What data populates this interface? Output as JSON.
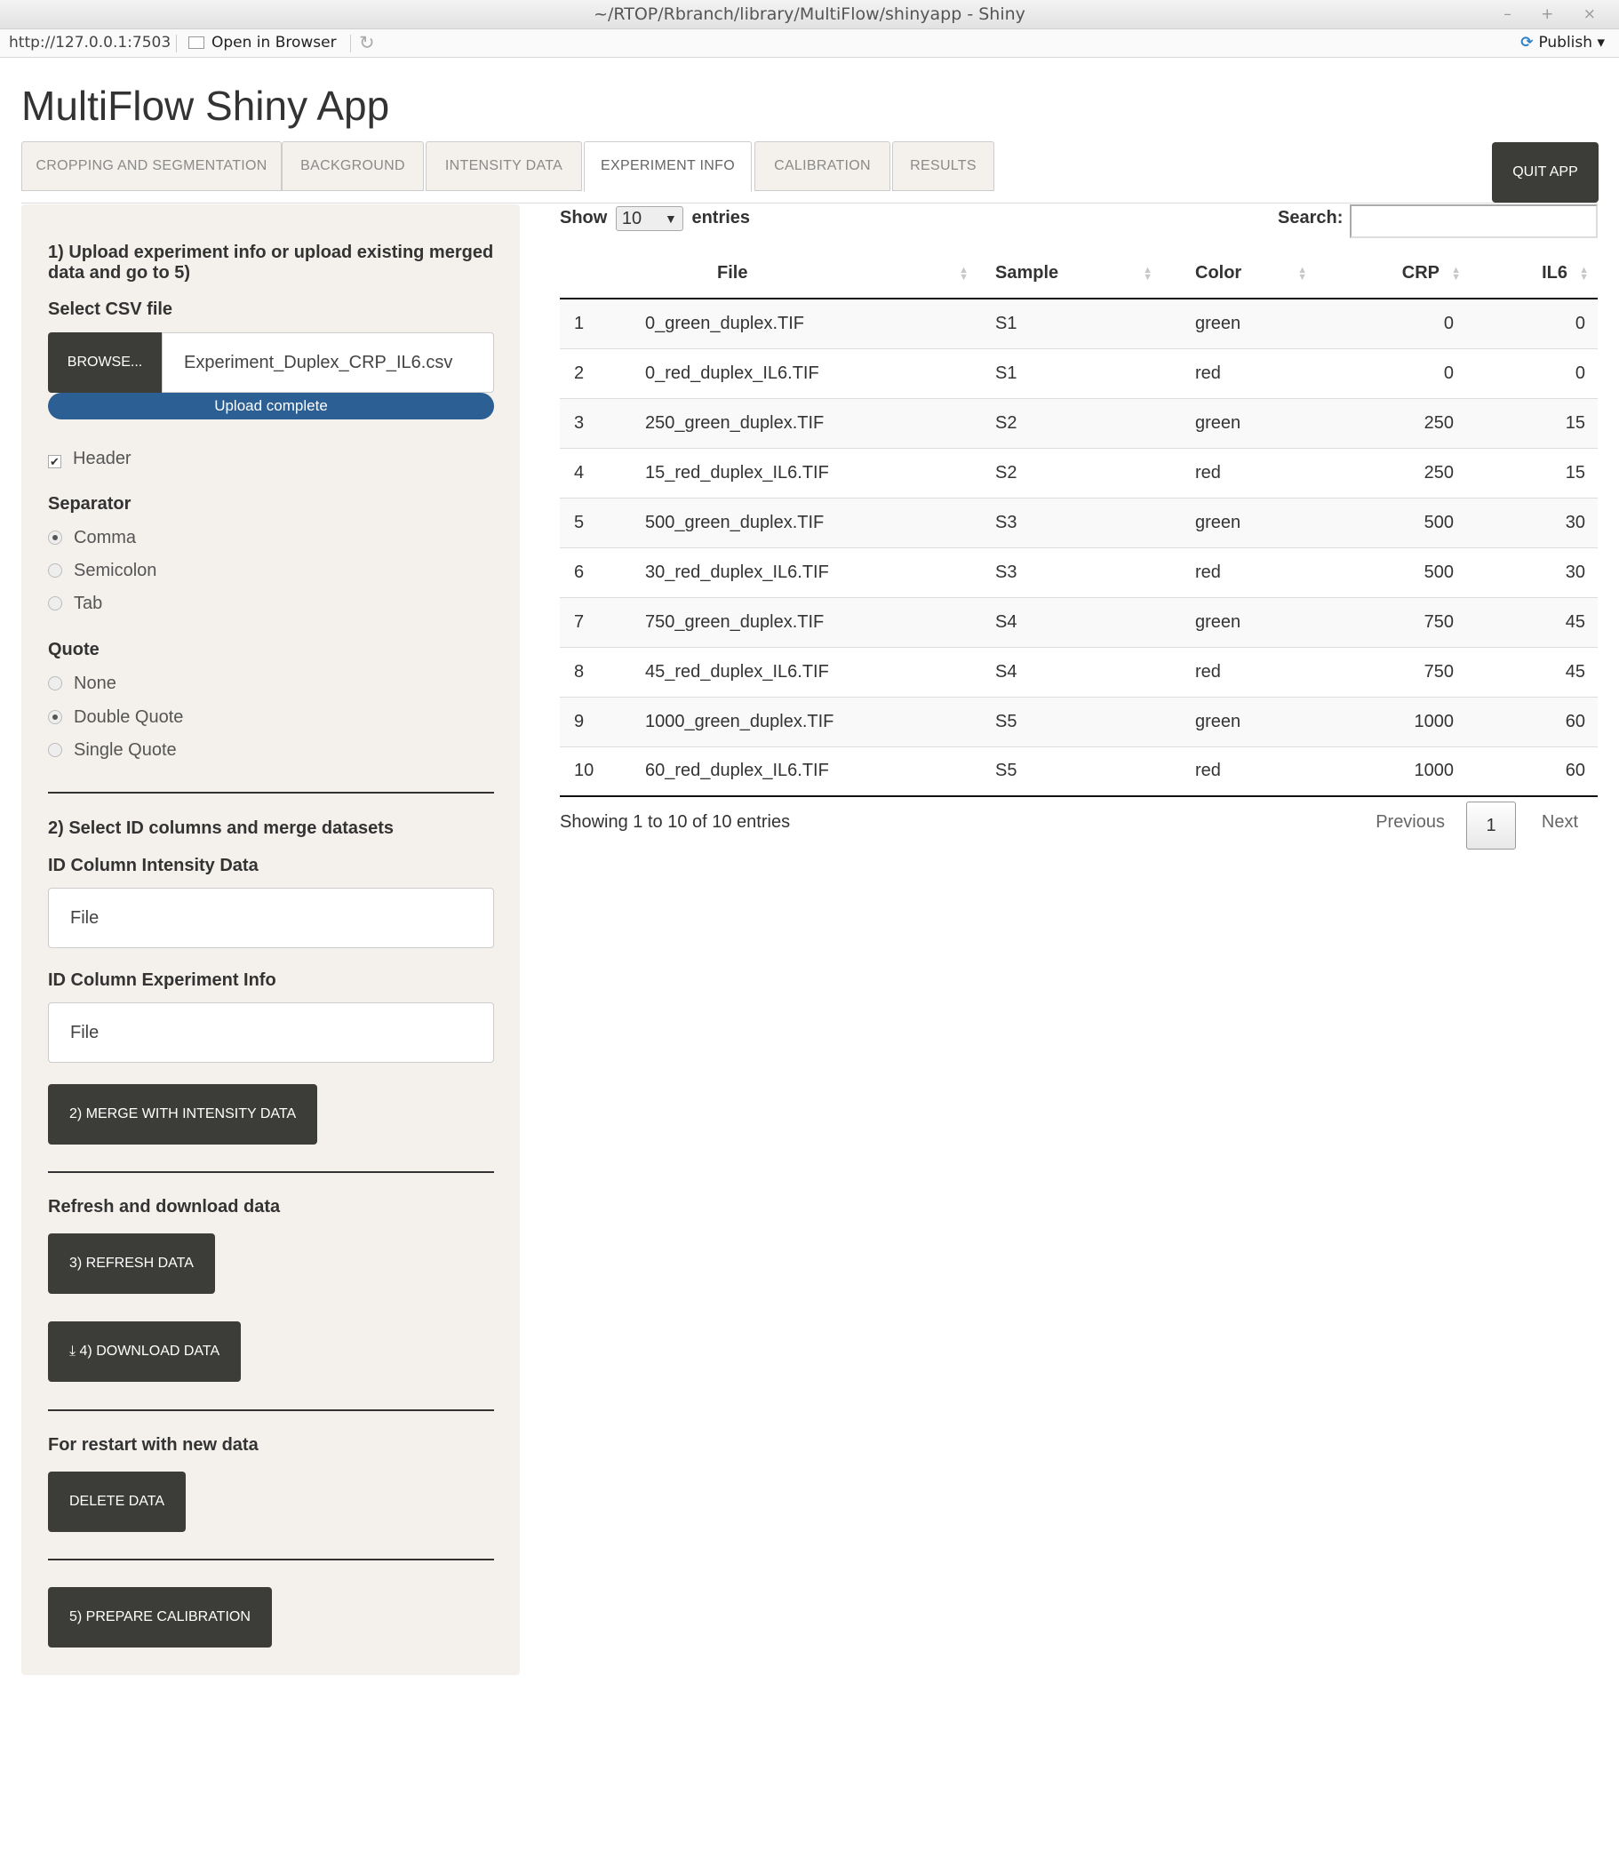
{
  "window": {
    "title": "~/RTOP/Rbranch/library/MultiFlow/shinyapp - Shiny",
    "controls": "– + ×"
  },
  "addressbar": {
    "url": "http://127.0.0.1:7503",
    "open_in_browser": "Open in Browser",
    "publish": "Publish",
    "publish_caret": "▾"
  },
  "app": {
    "title": "MultiFlow Shiny App",
    "quit_label": "QUIT APP"
  },
  "tabs": [
    {
      "label": "CROPPING AND SEGMENTATION"
    },
    {
      "label": "BACKGROUND"
    },
    {
      "label": "INTENSITY DATA"
    },
    {
      "label": "EXPERIMENT INFO",
      "active": true
    },
    {
      "label": "CALIBRATION"
    },
    {
      "label": "RESULTS"
    }
  ],
  "sidebar": {
    "step1_heading": "1) Upload experiment info or upload existing merged data and go to 5)",
    "select_csv_label": "Select CSV file",
    "browse_label": "BROWSE...",
    "file_name": "Experiment_Duplex_CRP_IL6.csv",
    "upload_status": "Upload complete",
    "upload_progress": 1.0,
    "header_label": "Header",
    "header_checked": true,
    "separator_label": "Separator",
    "separator_options": [
      "Comma",
      "Semicolon",
      "Tab"
    ],
    "separator_selected": "Comma",
    "quote_label": "Quote",
    "quote_options": [
      "None",
      "Double Quote",
      "Single Quote"
    ],
    "quote_selected": "Double Quote",
    "step2_heading": "2) Select ID columns and merge datasets",
    "id_intensity_label": "ID Column Intensity Data",
    "id_intensity_value": "File",
    "id_experiment_label": "ID Column Experiment Info",
    "id_experiment_value": "File",
    "merge_button": "2) MERGE WITH INTENSITY DATA",
    "refresh_heading": "Refresh and download data",
    "refresh_button": "3) REFRESH DATA",
    "download_button": "4) DOWNLOAD DATA",
    "restart_heading": "For restart with new data",
    "delete_button": "DELETE DATA",
    "prepare_button": "5) PREPARE CALIBRATION"
  },
  "table": {
    "show_label": "Show",
    "entries_label": "entries",
    "length_value": "10",
    "search_label": "Search:",
    "search_value": "",
    "columns": [
      "",
      "File",
      "Sample",
      "Color",
      "CRP",
      "IL6"
    ],
    "rows": [
      [
        "1",
        "0_green_duplex.TIF",
        "S1",
        "green",
        "0",
        "0"
      ],
      [
        "2",
        "0_red_duplex_IL6.TIF",
        "S1",
        "red",
        "0",
        "0"
      ],
      [
        "3",
        "250_green_duplex.TIF",
        "S2",
        "green",
        "250",
        "15"
      ],
      [
        "4",
        "15_red_duplex_IL6.TIF",
        "S2",
        "red",
        "250",
        "15"
      ],
      [
        "5",
        "500_green_duplex.TIF",
        "S3",
        "green",
        "500",
        "30"
      ],
      [
        "6",
        "30_red_duplex_IL6.TIF",
        "S3",
        "red",
        "500",
        "30"
      ],
      [
        "7",
        "750_green_duplex.TIF",
        "S4",
        "green",
        "750",
        "45"
      ],
      [
        "8",
        "45_red_duplex_IL6.TIF",
        "S4",
        "red",
        "750",
        "45"
      ],
      [
        "9",
        "1000_green_duplex.TIF",
        "S5",
        "green",
        "1000",
        "60"
      ],
      [
        "10",
        "60_red_duplex_IL6.TIF",
        "S5",
        "red",
        "1000",
        "60"
      ]
    ],
    "info": "Showing 1 to 10 of 10 entries",
    "previous": "Previous",
    "current_page": "1",
    "next": "Next"
  },
  "colors": {
    "dark_button": "#3c3c38",
    "progress_bar": "#2c5f94",
    "sidebar_bg": "#f4f1ec"
  },
  "icons": {
    "open_in_browser": "browser-window-icon",
    "refresh": "refresh-icon",
    "publish": "publish-icon",
    "download": "download-icon",
    "sort": "sort-arrows-icon"
  }
}
